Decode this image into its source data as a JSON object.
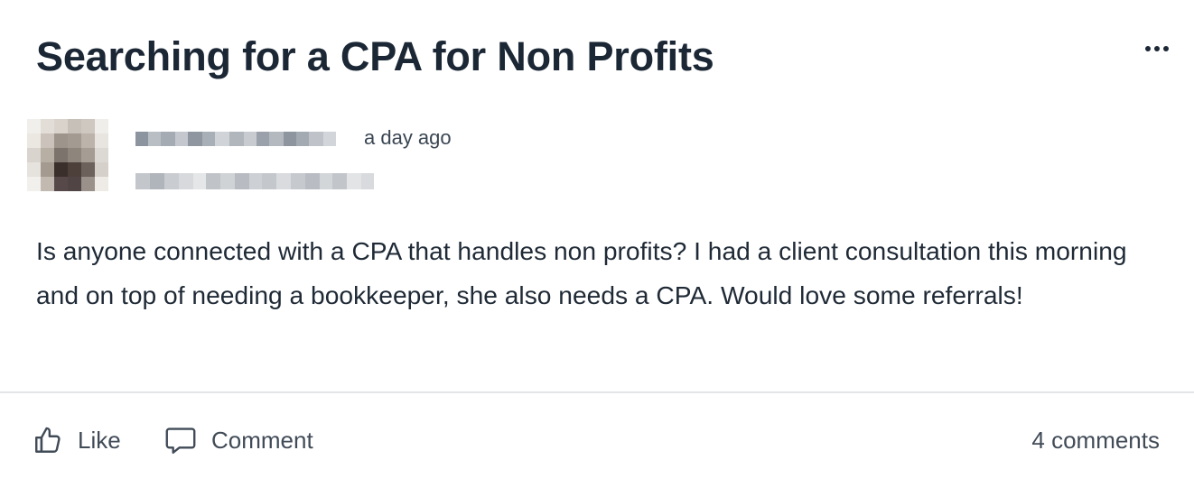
{
  "post": {
    "title": "Searching for a CPA for Non Profits",
    "more_icon": "more-horizontal-icon",
    "author": {
      "avatar_icon": "avatar-pixelated",
      "name_redacted": true,
      "subtitle_redacted": true
    },
    "timestamp": "a day ago",
    "body": "Is anyone connected with a CPA that handles non profits? I had a client consultation this morning and on top of needing a bookkeeper, she also needs a CPA. Would love some referrals!"
  },
  "actions": {
    "like_label": "Like",
    "like_icon": "thumbs-up-icon",
    "comment_label": "Comment",
    "comment_icon": "speech-bubble-icon",
    "comment_count": "4 comments"
  },
  "colors": {
    "title": "#1b2735",
    "body": "#1f2a36",
    "muted": "#414b57",
    "divider": "#e3e5e8"
  }
}
